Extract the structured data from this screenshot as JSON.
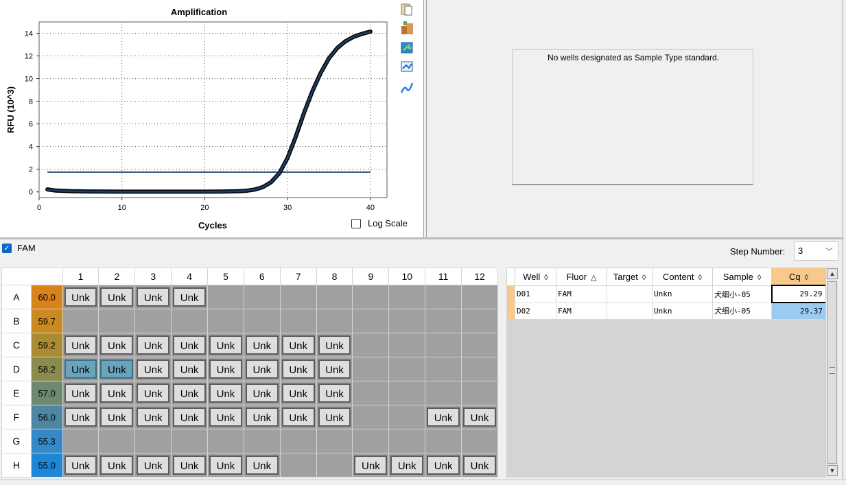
{
  "chart_data": {
    "type": "line",
    "title": "Amplification",
    "xlabel": "Cycles",
    "ylabel": "RFU (10^3)",
    "xlim": [
      0,
      42
    ],
    "ylim": [
      -0.5,
      15
    ],
    "x_ticks": [
      "0",
      "10",
      "20",
      "30",
      "40"
    ],
    "y_ticks": [
      "0",
      "2",
      "4",
      "6",
      "8",
      "10",
      "12",
      "14"
    ],
    "grid": true,
    "threshold": 1.75,
    "series": [
      {
        "x": [
          1,
          2,
          4,
          6,
          8,
          10,
          12,
          14,
          16,
          18,
          20,
          22,
          24,
          25,
          26,
          27,
          28,
          29,
          30,
          31,
          32,
          33,
          34,
          35,
          36,
          37,
          38,
          39,
          40
        ],
        "values": [
          0.22,
          0.12,
          0.06,
          0.04,
          0.03,
          0.02,
          0.02,
          0.02,
          0.02,
          0.02,
          0.02,
          0.03,
          0.06,
          0.1,
          0.2,
          0.42,
          0.85,
          1.65,
          3.0,
          4.9,
          7.0,
          8.9,
          10.5,
          11.8,
          12.7,
          13.3,
          13.7,
          13.95,
          14.15
        ]
      }
    ],
    "colors": {
      "curve": "#1f3d63",
      "curve_outline": "#000000",
      "threshold": "#1f4f7a"
    }
  },
  "log_scale": {
    "label": "Log Scale",
    "checked": false
  },
  "toolbar_icons": [
    "copy-icon",
    "export-icon",
    "refresh-icon",
    "chart-settings-icon",
    "curve-icon"
  ],
  "standard_curve": {
    "message": "No wells designated as Sample Type standard."
  },
  "fluor_filter": {
    "label": "FAM",
    "checked": true
  },
  "step": {
    "label": "Step Number:",
    "value": "3"
  },
  "plate": {
    "columns": [
      "1",
      "2",
      "3",
      "4",
      "5",
      "6",
      "7",
      "8",
      "9",
      "10",
      "11",
      "12"
    ],
    "rows": [
      {
        "label": "A",
        "temp": "60.0",
        "temp_color": "#d9831a",
        "wells": [
          "Unk",
          "Unk",
          "Unk",
          "Unk",
          "",
          "",
          "",
          "",
          "",
          "",
          "",
          ""
        ]
      },
      {
        "label": "B",
        "temp": "59.7",
        "temp_color": "#c98a20",
        "wells": [
          "",
          "",
          "",
          "",
          "",
          "",
          "",
          "",
          "",
          "",
          "",
          ""
        ]
      },
      {
        "label": "C",
        "temp": "59.2",
        "temp_color": "#a98c34",
        "wells": [
          "Unk",
          "Unk",
          "Unk",
          "Unk",
          "Unk",
          "Unk",
          "Unk",
          "Unk",
          "",
          "",
          "",
          ""
        ]
      },
      {
        "label": "D",
        "temp": "58.2",
        "temp_color": "#8a8b4f",
        "wells": [
          "Unk",
          "Unk",
          "Unk",
          "Unk",
          "Unk",
          "Unk",
          "Unk",
          "Unk",
          "",
          "",
          "",
          ""
        ]
      },
      {
        "label": "E",
        "temp": "57.0",
        "temp_color": "#6d8a70",
        "wells": [
          "Unk",
          "Unk",
          "Unk",
          "Unk",
          "Unk",
          "Unk",
          "Unk",
          "Unk",
          "",
          "",
          "",
          ""
        ]
      },
      {
        "label": "F",
        "temp": "56.0",
        "temp_color": "#4f86a3",
        "wells": [
          "Unk",
          "Unk",
          "Unk",
          "Unk",
          "Unk",
          "Unk",
          "Unk",
          "Unk",
          "",
          "",
          "Unk",
          "Unk"
        ]
      },
      {
        "label": "G",
        "temp": "55.3",
        "temp_color": "#3589c8",
        "wells": [
          "",
          "",
          "",
          "",
          "",
          "",
          "",
          "",
          "",
          "",
          "",
          ""
        ]
      },
      {
        "label": "H",
        "temp": "55.0",
        "temp_color": "#1f86d8",
        "wells": [
          "Unk",
          "Unk",
          "Unk",
          "Unk",
          "Unk",
          "Unk",
          "",
          "",
          "Unk",
          "Unk",
          "Unk",
          "Unk"
        ]
      }
    ],
    "selected_wells": [
      "D1",
      "D2"
    ]
  },
  "results": {
    "columns": [
      {
        "label": "Well",
        "sort": "◊"
      },
      {
        "label": "Fluor",
        "sort": "△"
      },
      {
        "label": "Target",
        "sort": "◊"
      },
      {
        "label": "Content",
        "sort": "◊"
      },
      {
        "label": "Sample",
        "sort": "◊"
      },
      {
        "label": "Cq",
        "sort": "◊"
      }
    ],
    "rows": [
      {
        "well": "D01",
        "fluor": "FAM",
        "target": "",
        "content": "Unkn",
        "sample": "犬细小-05",
        "cq": "29.29"
      },
      {
        "well": "D02",
        "fluor": "FAM",
        "target": "",
        "content": "Unkn",
        "sample": "犬细小-05",
        "cq": "29.37"
      }
    ]
  }
}
